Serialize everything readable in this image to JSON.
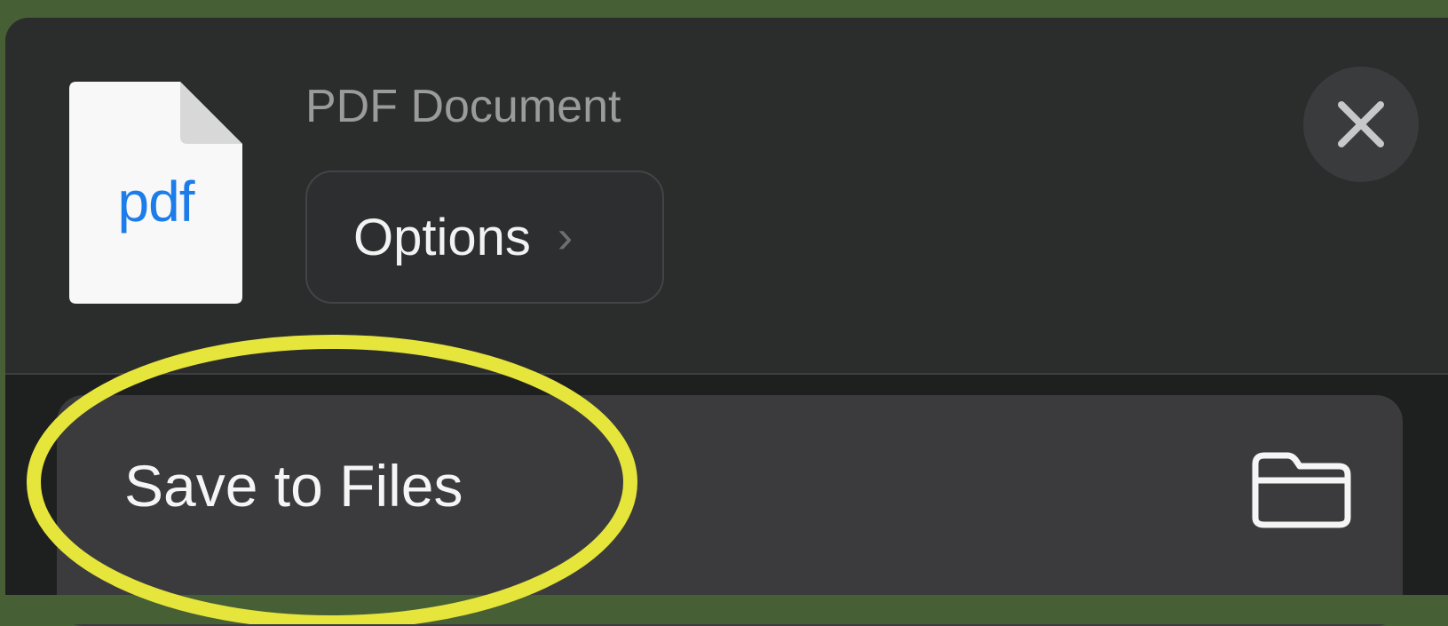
{
  "share_sheet": {
    "file_type_label": "pdf",
    "document_title": "PDF Document",
    "options_label": "Options",
    "close_icon": "close-icon",
    "chevron_icon": "chevron-right-icon"
  },
  "actions": [
    {
      "label": "Save to Files",
      "icon": "folder-icon"
    }
  ],
  "annotation": {
    "type": "ellipse",
    "color": "#e6e53c"
  },
  "colors": {
    "background": "#465f35",
    "sheet": "#2b2c2c",
    "row": "#3b3b3e",
    "pdf_blue": "#1c7cea"
  }
}
